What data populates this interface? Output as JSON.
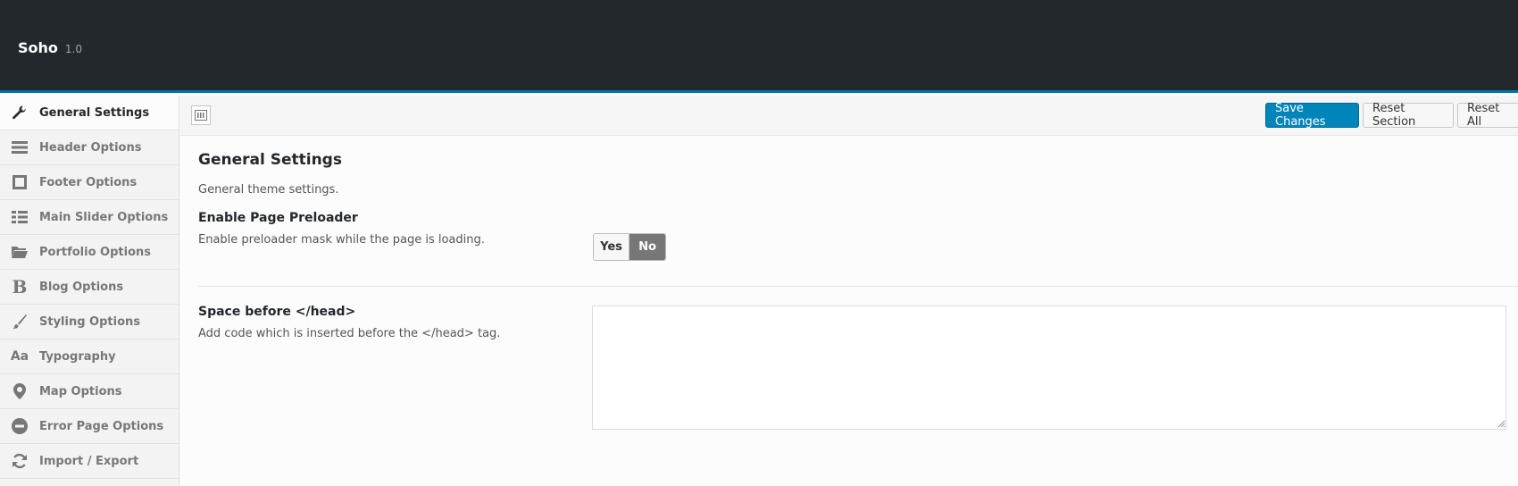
{
  "app": {
    "name": "Soho",
    "version": "1.0"
  },
  "sidebar": {
    "items": [
      {
        "label": "General Settings",
        "icon": "wrench-icon"
      },
      {
        "label": "Header Options",
        "icon": "bars-icon"
      },
      {
        "label": "Footer Options",
        "icon": "square-icon"
      },
      {
        "label": "Main Slider Options",
        "icon": "slider-icon"
      },
      {
        "label": "Portfolio Options",
        "icon": "folder-icon"
      },
      {
        "label": "Blog Options",
        "icon": "bold-b-icon"
      },
      {
        "label": "Styling Options",
        "icon": "brush-icon"
      },
      {
        "label": "Typography",
        "icon": "font-aa-icon"
      },
      {
        "label": "Map Options",
        "icon": "map-marker-icon"
      },
      {
        "label": "Error Page Options",
        "icon": "minus-circle-icon"
      },
      {
        "label": "Import / Export",
        "icon": "refresh-icon"
      }
    ]
  },
  "toolbar": {
    "save_label": "Save Changes",
    "reset_section_label": "Reset Section",
    "reset_all_label": "Reset All"
  },
  "main": {
    "title": "General Settings",
    "description": "General theme settings.",
    "fields": [
      {
        "title": "Enable Page Preloader",
        "description": "Enable preloader mask while the page is loading.",
        "options": {
          "yes": "Yes",
          "no": "No"
        },
        "selected": "No"
      },
      {
        "title": "Space before </head>",
        "description": "Add code which is inserted before the </head> tag.",
        "value": ""
      }
    ]
  },
  "colors": {
    "topbar": "#23282d",
    "accent": "#0073aa",
    "primary_button": "#0085ba"
  }
}
